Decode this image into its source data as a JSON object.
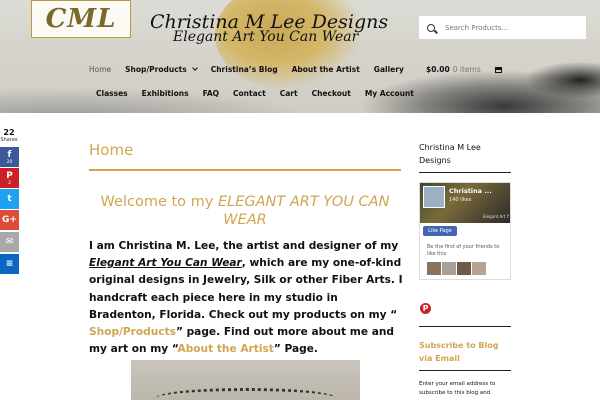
{
  "site": {
    "logo_text": "CML",
    "title": "Christina M Lee Designs",
    "tagline": "Elegant Art You Can Wear"
  },
  "search": {
    "placeholder": "Search Products..."
  },
  "nav_primary": [
    {
      "label": "Home"
    },
    {
      "label": "Shop/Products"
    },
    {
      "label": "Christina’s Blog"
    },
    {
      "label": "About the Artist"
    },
    {
      "label": "Gallery"
    }
  ],
  "nav_secondary": [
    {
      "label": "Classes"
    },
    {
      "label": "Exhibitions"
    },
    {
      "label": "FAQ"
    },
    {
      "label": "Contact"
    },
    {
      "label": "Cart"
    },
    {
      "label": "Checkout"
    },
    {
      "label": "My Account"
    }
  ],
  "cart": {
    "amount": "$0.00",
    "items": "0 items"
  },
  "share": {
    "count": "22",
    "label": "Shares",
    "facebook": {
      "count": "20",
      "glyph": "f"
    },
    "pinterest": {
      "count": "2",
      "glyph": "P"
    },
    "twitter": {
      "glyph": "t"
    },
    "googleplus": {
      "glyph": "G+"
    },
    "email": {
      "glyph": "✉"
    },
    "sumo": {
      "glyph": "≡"
    }
  },
  "main": {
    "page_title": "Home",
    "welcome_prefix": "Welcome to my ",
    "welcome_emph": "ELEGANT ART YOU CAN WEAR",
    "intro_1": "I am Christina M. Lee, the artist and designer of my ",
    "intro_brand": "Elegant Art You Can Wear",
    "intro_2": ", which are my one-of-kind original designs in Jewelry, Silk or other Fiber Arts.  I handcraft each piece here in my studio in Bradenton, Florida.  Check out my products on my “ ",
    "intro_link_shop": "Shop/Products",
    "intro_3": "” page.  Find out more about me and my art on my “",
    "intro_link_about": "About the Artist",
    "intro_4": "” Page."
  },
  "sidebar": {
    "title": "Christina M Lee Designs",
    "fb": {
      "page_name": "Christina ...",
      "likes": "140 likes",
      "small": "Elegant Art Y",
      "like_button": "Like Page",
      "friends_text": "Be the first of your friends to like this"
    },
    "pin_glyph": "P",
    "subscribe_title": "Subscribe to Blog via Email",
    "subscribe_desc": "Enter your email address to subscribe to this blog and"
  },
  "colors": {
    "accent": "#d1a552",
    "facebook": "#3b5998",
    "pinterest": "#cb2027",
    "twitter": "#1da1f2",
    "googleplus": "#dd4b39",
    "email": "#a9a9a9",
    "sumo": "#0a66c2"
  }
}
